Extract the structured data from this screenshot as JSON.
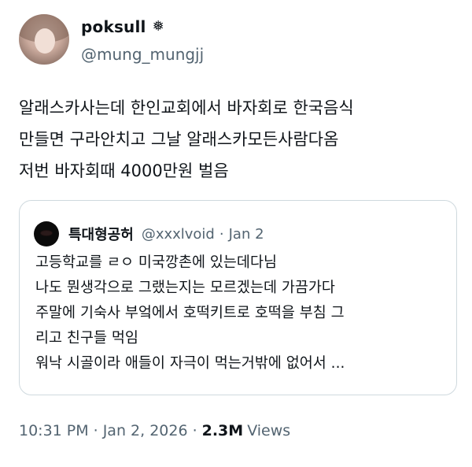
{
  "author": {
    "display_name": "poksull",
    "badge_glyph": "❅",
    "handle": "@mung_mungjj"
  },
  "tweet": {
    "text": "알래스카사는데 한인교회에서 바자회로 한국음식\n만들면 구라안치고 그날 알래스카모든사람다옴\n저번 바자회때 4000만원 벌음"
  },
  "quote": {
    "display_name": "특대형공허",
    "handle": "@xxxlvoid",
    "separator": "·",
    "date": "Jan 2",
    "text": "고등학교를 ㄹㅇ 미국깡촌에 있는데다님\n나도 뭔생각으로 그랬는지는 모르겠는데 가끔가다\n주말에 기숙사 부엌에서 호떡키트로 호떡을 부침 그\n리고 친구들 먹임\n워낙 시골이라 애들이 자극이 먹는거밖에 없어서 ..."
  },
  "meta": {
    "time": "10:31 PM",
    "separator": "·",
    "date": "Jan 2, 2026",
    "views_count": "2.3M",
    "views_label": "Views"
  }
}
